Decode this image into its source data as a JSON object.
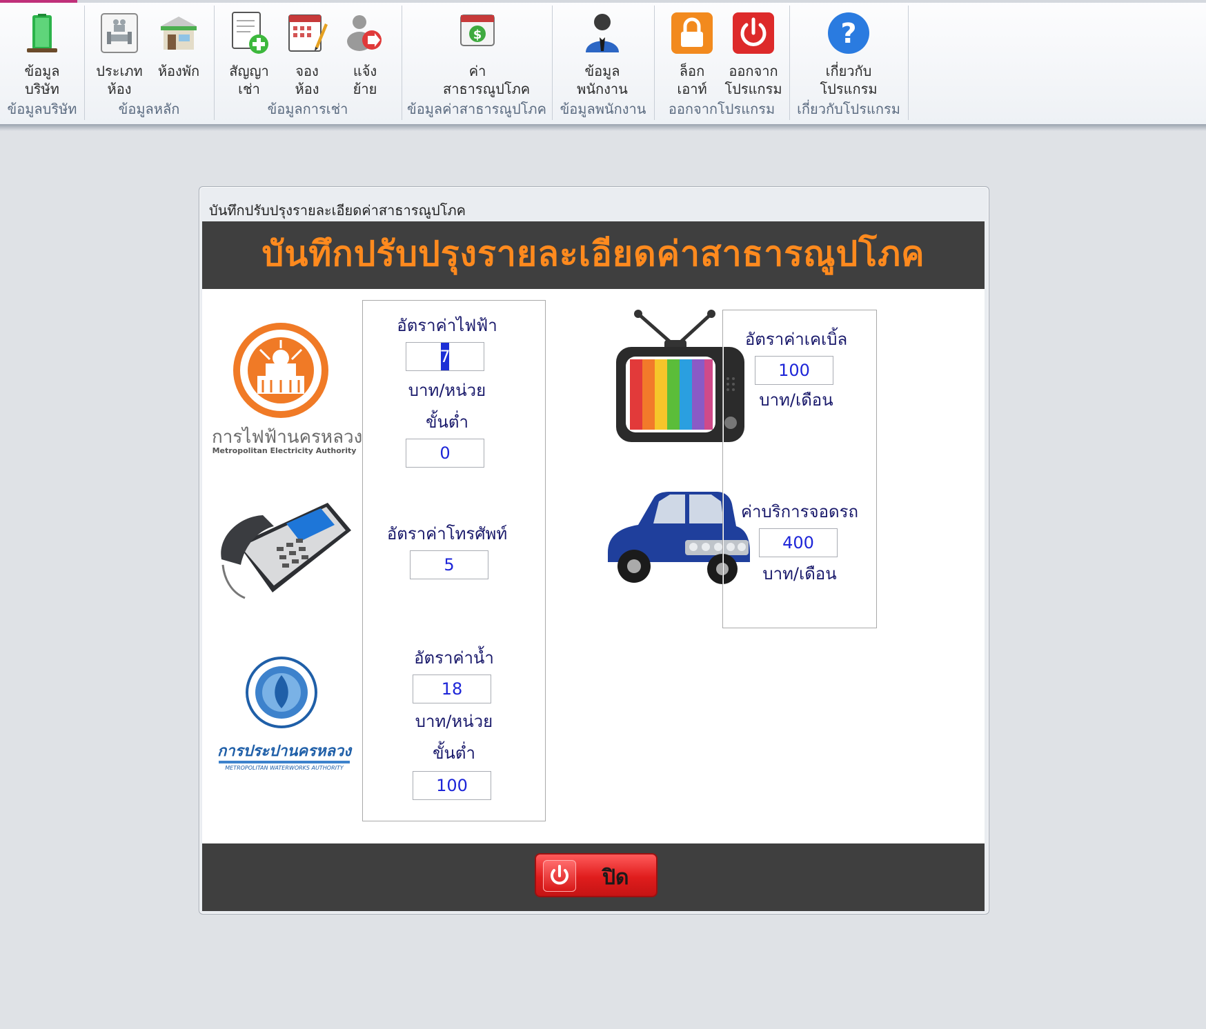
{
  "ribbon": {
    "groups": [
      {
        "caption": "ข้อมูลบริษัท",
        "buttons": [
          {
            "line1": "ข้อมูล",
            "line2": "บริษัท",
            "icon": "building-icon"
          }
        ]
      },
      {
        "caption": "ข้อมูลหลัก",
        "buttons": [
          {
            "line1": "ประเภท",
            "line2": "ห้อง",
            "icon": "room-type-icon"
          },
          {
            "line1": "ห้องพัก",
            "line2": "",
            "icon": "store-icon"
          }
        ]
      },
      {
        "caption": "ข้อมูลการเช่า",
        "buttons": [
          {
            "line1": "สัญญา",
            "line2": "เช่า",
            "icon": "contract-add-icon"
          },
          {
            "line1": "จอง",
            "line2": "ห้อง",
            "icon": "calendar-booking-icon"
          },
          {
            "line1": "แจ้ง",
            "line2": "ย้าย",
            "icon": "person-move-icon"
          }
        ]
      },
      {
        "caption": "ข้อมูลค่าสาธารณูปโภค",
        "buttons": [
          {
            "line1": "ค่า",
            "line2": "สาธารณูปโภค",
            "icon": "bill-dollar-icon"
          }
        ]
      },
      {
        "caption": "ข้อมูลพนักงาน",
        "buttons": [
          {
            "line1": "ข้อมูล",
            "line2": "พนักงาน",
            "icon": "employee-icon"
          }
        ]
      },
      {
        "caption": "ออกจากโปรแกรม",
        "buttons": [
          {
            "line1": "ล็อก",
            "line2": "เอาท์",
            "icon": "lock-icon"
          },
          {
            "line1": "ออกจาก",
            "line2": "โปรแกรม",
            "icon": "power-icon"
          }
        ]
      },
      {
        "caption": "เกี่ยวกับโปรแกรม",
        "buttons": [
          {
            "line1": "เกี่ยวกับ",
            "line2": "โปรแกรม",
            "icon": "help-icon"
          }
        ]
      }
    ]
  },
  "dialog": {
    "window_title": "บันทึกปรับปรุงรายละเอียดค่าสาธารณูปโภค",
    "header_title": "บันทึกปรับปรุงรายละเอียดค่าสาธารณูปโภค",
    "logos": {
      "mea_th": "การไฟฟ้านครหลวง",
      "mea_en": "Metropolitan Electricity Authority",
      "mwa_th": "การประปานครหลวง",
      "mwa_en": "METROPOLITAN WATERWORKS AUTHORITY"
    },
    "electricity": {
      "label": "อัตราค่าไฟฟ้า",
      "rate": "7",
      "unit": "บาท/หน่วย",
      "min_label": "ขั้นต่ำ",
      "min": "0"
    },
    "phone": {
      "label": "อัตราค่าโทรศัพท์",
      "rate": "5"
    },
    "water": {
      "label": "อัตราค่าน้ำ",
      "rate": "18",
      "unit": "บาท/หน่วย",
      "min_label": "ขั้นต่ำ",
      "min": "100"
    },
    "cable": {
      "label": "อัตราค่าเคเบิ้ล",
      "rate": "100",
      "unit": "บาท/เดือน"
    },
    "parking": {
      "label": "ค่าบริการจอดรถ",
      "rate": "400",
      "unit": "บาท/เดือน"
    },
    "close_label": "ปิด",
    "colors": {
      "header_bg": "#3f3f3f",
      "header_text": "#ff8a1e",
      "value_text": "#1d25d8",
      "close_btn": "#e01d1d"
    }
  }
}
